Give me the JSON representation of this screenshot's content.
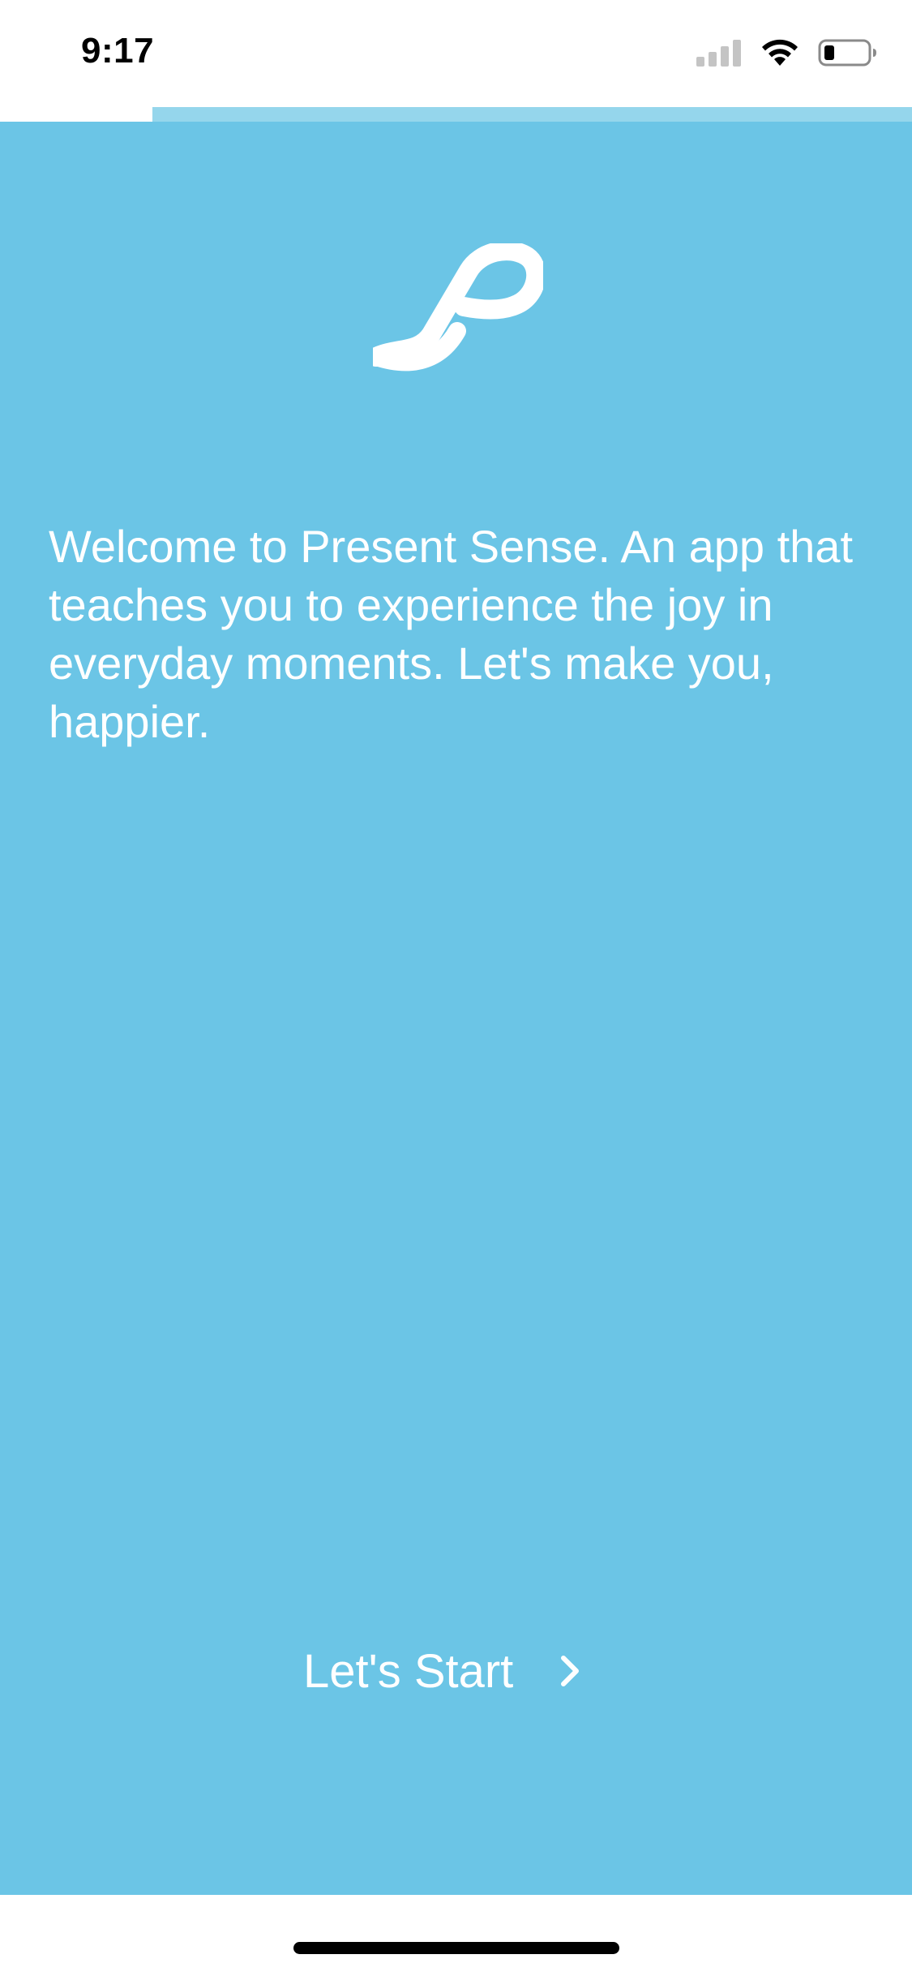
{
  "status_bar": {
    "time": "9:17",
    "icons": [
      "cellular-signal-icon",
      "wifi-icon",
      "battery-icon"
    ],
    "battery_level": 0.2
  },
  "onboarding": {
    "progress": 0.167,
    "logo_icon": "present-sense-logo-icon",
    "welcome_text": "Welcome to Present Sense. An app that teaches you to experience the joy in everyday moments. Let's make you, happier.",
    "start_label": "Let's Start",
    "start_icon": "chevron-right-icon"
  },
  "colors": {
    "brand_blue": "#6bc5e6",
    "progress_track": "#95d6ec",
    "text_white": "#ffffff"
  }
}
